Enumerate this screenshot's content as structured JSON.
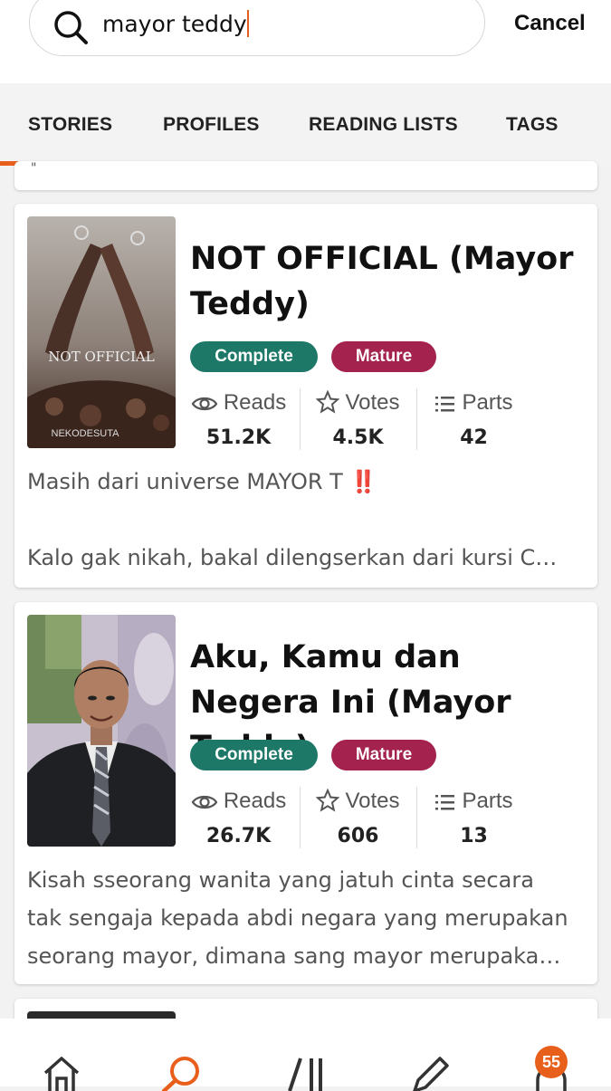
{
  "search": {
    "query": "mayor teddy",
    "cancel_label": "Cancel"
  },
  "tabs": [
    {
      "label": "STORIES",
      "active": true
    },
    {
      "label": "PROFILES"
    },
    {
      "label": "READING LISTS"
    },
    {
      "label": "TAGS"
    }
  ],
  "stories": [
    {
      "title": "NOT OFFICIAL (Mayor Teddy)",
      "badges": [
        "Complete",
        "Mature"
      ],
      "cover_text": {
        "title": "NOT OFFICIAL",
        "author": "NEKODESUTA"
      },
      "stats": [
        {
          "label": "Reads",
          "value": "51.2K"
        },
        {
          "label": "Votes",
          "value": "4.5K"
        },
        {
          "label": "Parts",
          "value": "42"
        }
      ],
      "description_lines": [
        "Masih dari universe MAYOR T ‼️",
        "",
        "Kalo gak nikah, bakal dilengserkan dari kursi C…"
      ]
    },
    {
      "title": "Aku, Kamu dan Negera Ini (Mayor Teddy)",
      "badges": [
        "Complete",
        "Mature"
      ],
      "stats": [
        {
          "label": "Reads",
          "value": "26.7K"
        },
        {
          "label": "Votes",
          "value": "606"
        },
        {
          "label": "Parts",
          "value": "13"
        }
      ],
      "description_lines": [
        "Kisah sseorang wanita yang jatuh cinta secara",
        "tak sengaja kepada abdi negara yang merupakan",
        "seorang mayor, dimana sang mayor merupaka…"
      ]
    }
  ],
  "bottom_nav": {
    "items": [
      "home-icon",
      "search-icon",
      "library-icon",
      "write-icon",
      "notifications-icon"
    ],
    "notification_count": "55"
  },
  "colors": {
    "accent": "#e85f1c",
    "complete": "#1d7868",
    "mature": "#a3224e"
  }
}
